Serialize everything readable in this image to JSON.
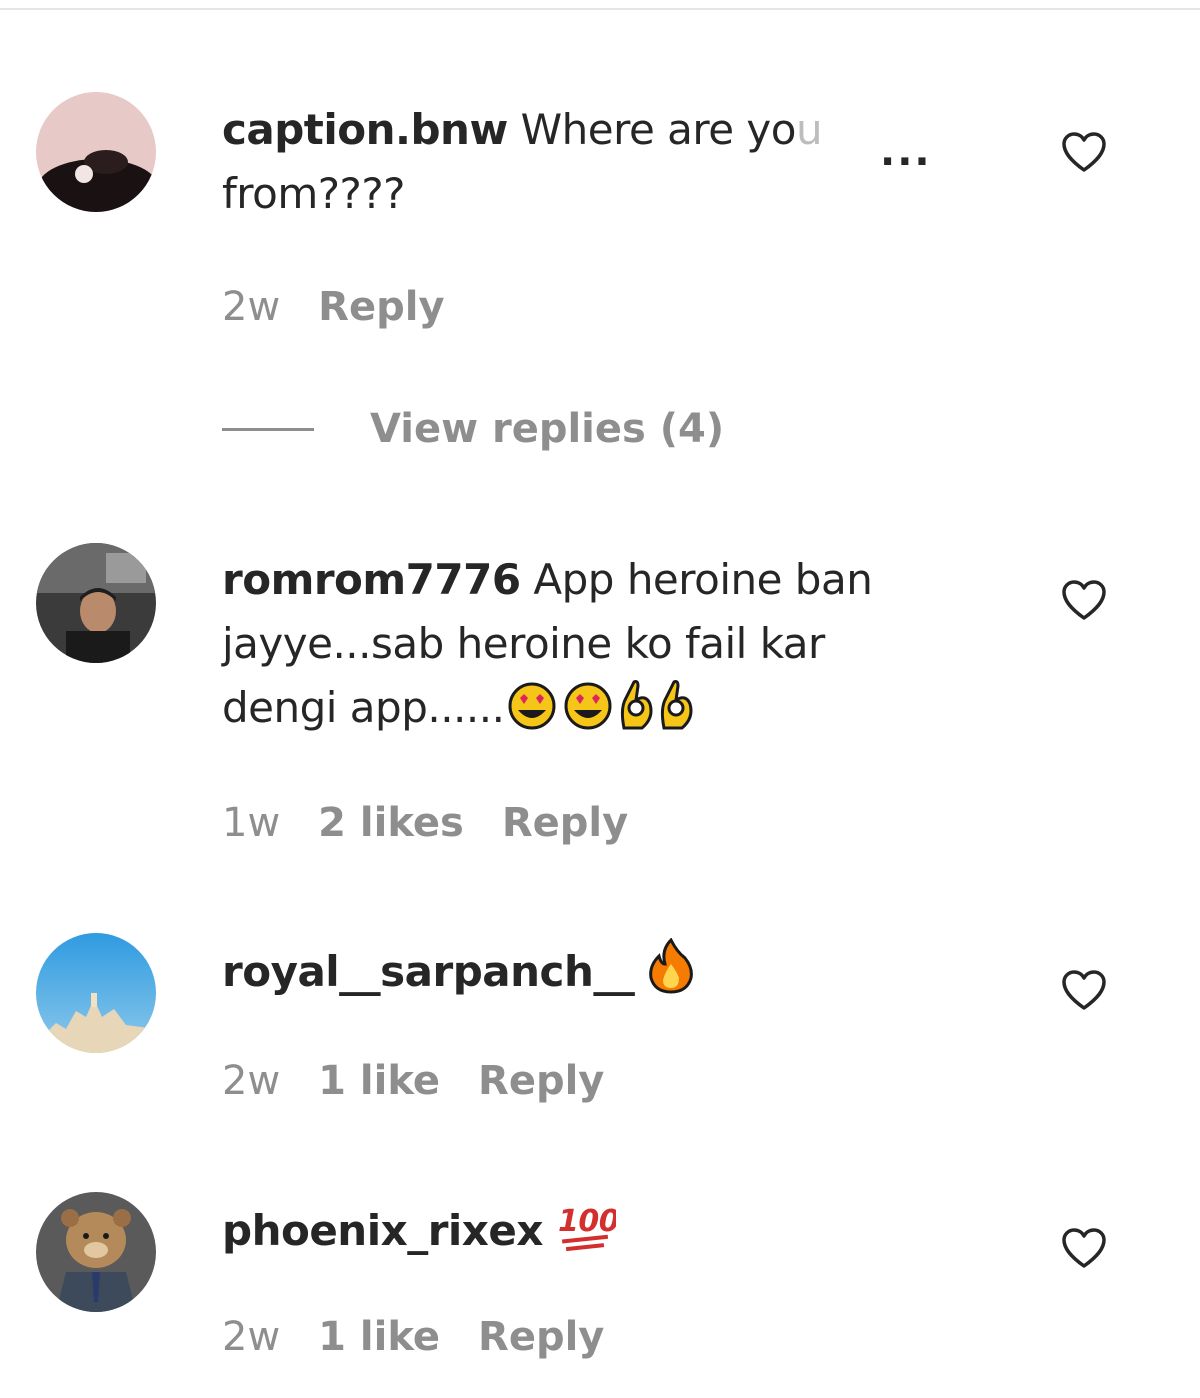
{
  "comments": [
    {
      "username": "caption.bnw",
      "text": " Where are yo",
      "text_faded": "u",
      "text_line2": "from????",
      "more_label": "...",
      "time": "2w",
      "likes": "",
      "reply_label": "Reply",
      "view_replies": "View replies (4)",
      "avatar_icon": "avatar-caption-bnw"
    },
    {
      "username": "romrom7776",
      "text": " App heroine ban jayye...sab heroine ko fail kar dengi app......",
      "emojis": [
        "heart-eyes-emoji",
        "heart-eyes-emoji",
        "ok-hand-emoji",
        "ok-hand-emoji"
      ],
      "time": "1w",
      "likes": "2 likes",
      "reply_label": "Reply",
      "avatar_icon": "avatar-romrom7776"
    },
    {
      "username": "royal__sarpanch__",
      "text": " ",
      "emojis": [
        "fire-emoji"
      ],
      "time": "2w",
      "likes": "1 like",
      "reply_label": "Reply",
      "avatar_icon": "avatar-royal-sarpanch"
    },
    {
      "username": "phoenix_rixex",
      "text": " ",
      "emojis": [
        "hundred-points-emoji"
      ],
      "time": "2w",
      "likes": "1 like",
      "reply_label": "Reply",
      "avatar_icon": "avatar-phoenix-rixex"
    }
  ],
  "icons": {
    "heart": "heart-outline-icon",
    "more": "more-dots-icon"
  },
  "colors": {
    "text": "#262626",
    "meta": "#8e8e8e",
    "emoji_yellow": "#f5c518",
    "emoji_red": "#e0245e"
  }
}
